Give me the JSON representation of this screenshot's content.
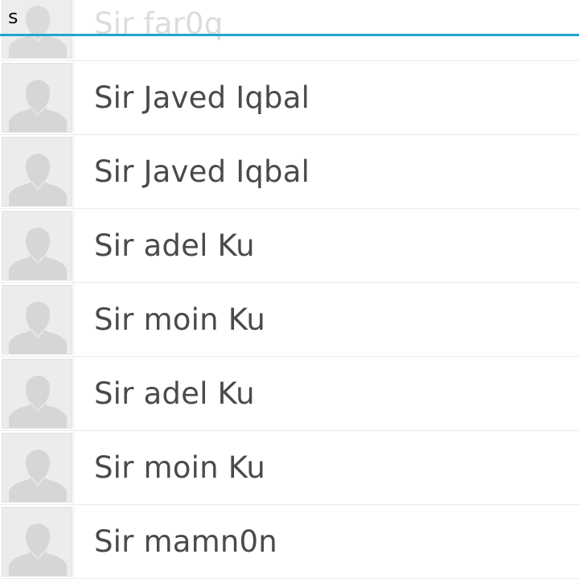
{
  "search": {
    "query": "s"
  },
  "contacts": [
    {
      "name": "Sir far0q"
    },
    {
      "name": "Sir Javed Iqbal"
    },
    {
      "name": "Sir Javed Iqbal"
    },
    {
      "name": "Sir adel Ku"
    },
    {
      "name": "Sir moin Ku"
    },
    {
      "name": "Sir adel Ku"
    },
    {
      "name": "Sir moin Ku"
    },
    {
      "name": "Sir mamn0n"
    }
  ],
  "colors": {
    "accent": "#22a5d0",
    "name_text": "#4a4a4a",
    "avatar_bg": "#ededed"
  },
  "icons": {
    "avatar": "default-person-silhouette-icon"
  }
}
